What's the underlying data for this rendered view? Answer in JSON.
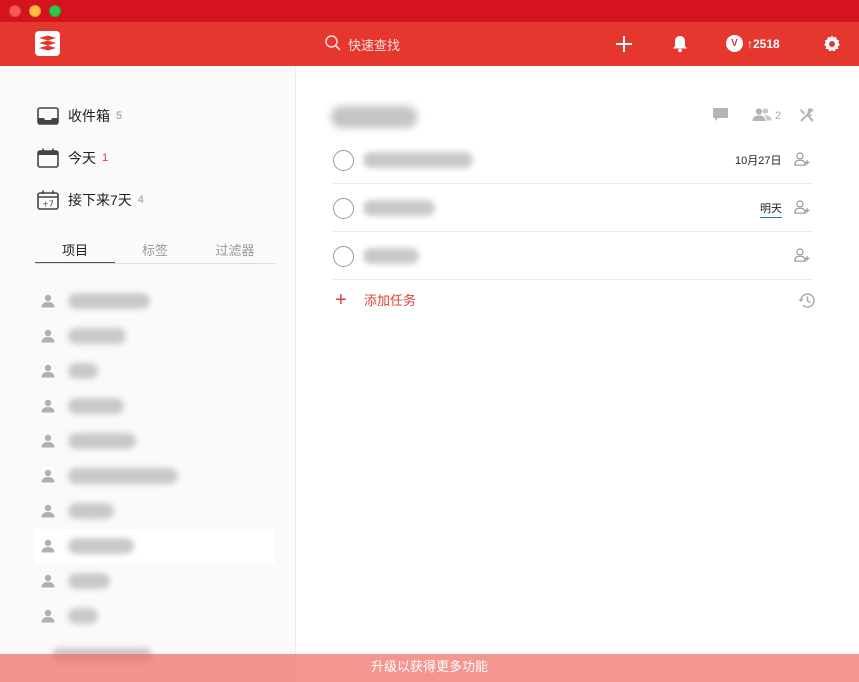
{
  "app": {
    "brand_color": "#e5372d"
  },
  "topbar": {
    "search_placeholder": "快速查找",
    "karma_value": "2518",
    "karma_arrow": "↑"
  },
  "sidebar": {
    "nav": [
      {
        "label": "收件箱",
        "count": "5",
        "icon": "inbox-icon"
      },
      {
        "label": "今天",
        "count": "1",
        "icon": "calendar-today-icon"
      },
      {
        "label": "接下来7天",
        "count": "4",
        "icon": "calendar-next7-icon"
      }
    ],
    "tabs": [
      "项目",
      "标签",
      "过滤器"
    ],
    "active_tab": "项目"
  },
  "main": {
    "collaborator_count": "2",
    "tasks": [
      {
        "due": "10月27日"
      },
      {
        "due": "明天"
      },
      {
        "due": ""
      }
    ],
    "add_task_label": "添加任务"
  },
  "banner": {
    "text": "升级以获得更多功能"
  }
}
